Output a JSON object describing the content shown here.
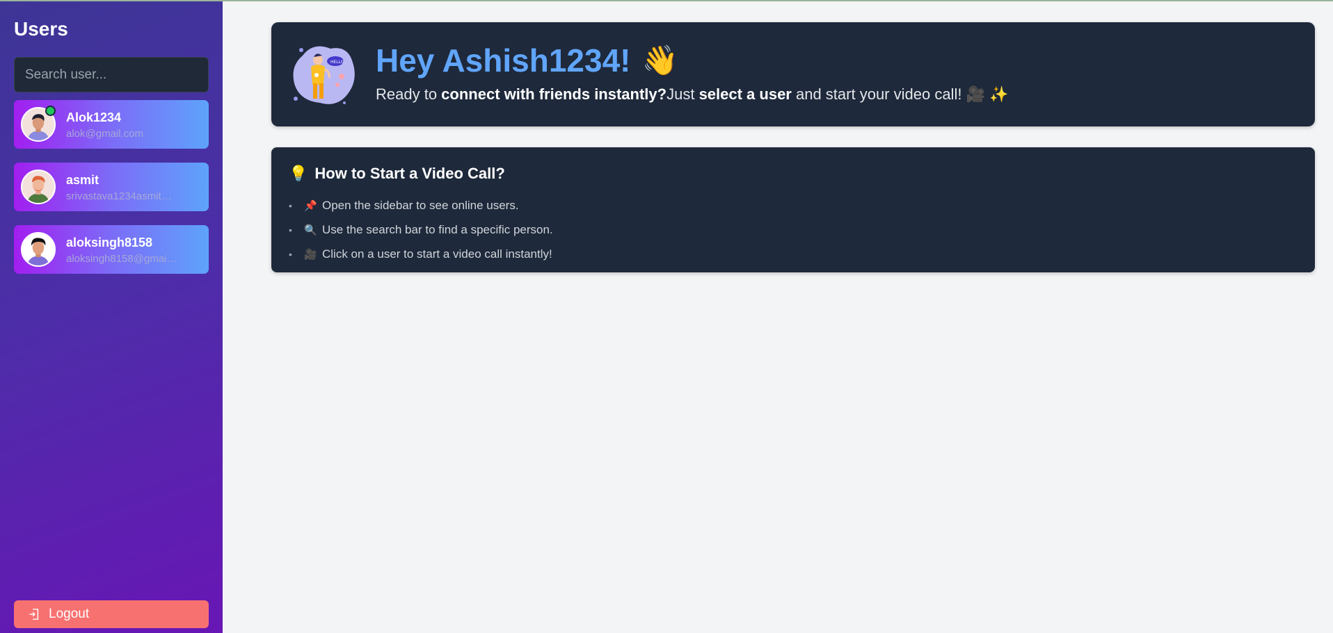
{
  "sidebar": {
    "title": "Users",
    "search_placeholder": "Search user...",
    "users": [
      {
        "name": "Alok1234",
        "email": "alok@gmail.com",
        "online": true,
        "avatar": "avatar-man-dark-hair"
      },
      {
        "name": "asmit",
        "email": "srivastava1234asmit@...",
        "online": false,
        "avatar": "avatar-man-red-hair"
      },
      {
        "name": "aloksingh8158",
        "email": "aloksingh8158@gmail...",
        "online": false,
        "avatar": "avatar-man-black-hair"
      }
    ],
    "logout_label": "Logout",
    "logout_icon": "logout-icon"
  },
  "welcome": {
    "greeting": "Hey Ashish1234!",
    "wave_emoji": "👋",
    "sub_prefix": "Ready to ",
    "sub_bold1": "connect with friends instantly?",
    "sub_middle": "Just ",
    "sub_bold2": "select a user",
    "sub_suffix": " and start your video call! 🎥 ✨",
    "illustration": "hello-chat-illustration"
  },
  "howto": {
    "icon": "💡",
    "title": "How to Start a Video Call?",
    "steps": [
      {
        "emoji": "📌",
        "text": "Open the sidebar to see online users."
      },
      {
        "emoji": "🔍",
        "text": "Use the search bar to find a specific person."
      },
      {
        "emoji": "🎥",
        "text": "Click on a user to start a video call instantly!"
      }
    ]
  },
  "colors": {
    "sidebar_gradient": [
      "#3d3596",
      "#6816b5"
    ],
    "card_gradient": [
      "#a21ef0",
      "#5ea3fb"
    ],
    "panel": "#1e293b",
    "greeting": "#60a5fa",
    "logout": "#f87171",
    "online": "#22c55e"
  }
}
